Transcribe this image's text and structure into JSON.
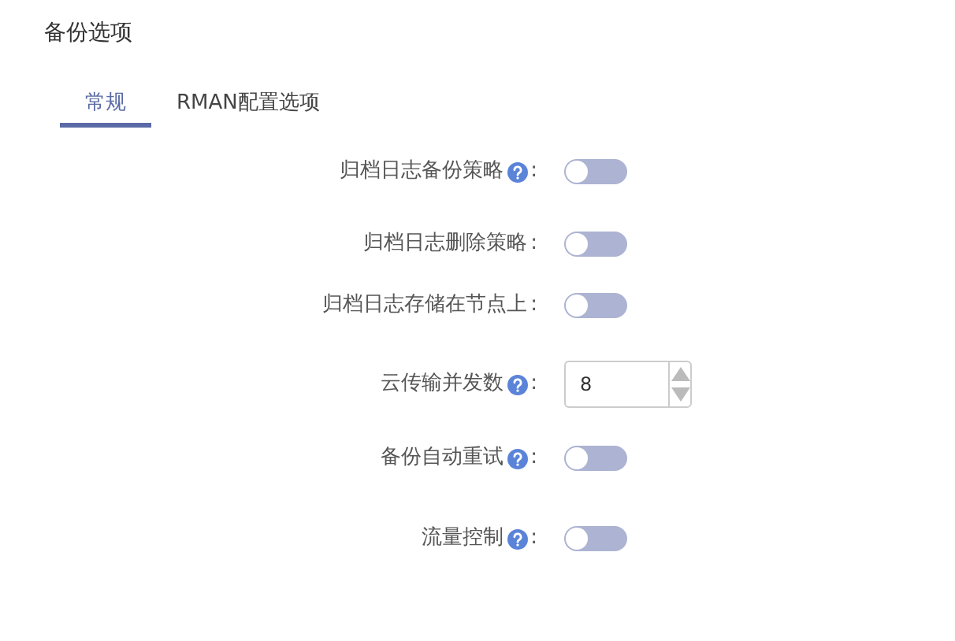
{
  "title": "备份选项",
  "tabs": [
    {
      "label": "常规",
      "selected": true
    },
    {
      "label": "RMAN配置选项",
      "selected": false
    }
  ],
  "fields": [
    {
      "kind": "switch",
      "label": "归档日志备份策略",
      "help": true,
      "colon": ":",
      "on": false
    },
    {
      "kind": "switch",
      "label": "归档日志删除策略",
      "help": false,
      "colon": ":",
      "on": false
    },
    {
      "kind": "switch",
      "label": "归档日志存储在节点上",
      "help": false,
      "colon": ":",
      "on": false
    },
    {
      "kind": "number",
      "label": "云传输并发数",
      "help": true,
      "colon": ":",
      "value": "8"
    },
    {
      "kind": "switch",
      "label": "备份自动重试",
      "help": true,
      "colon": ":",
      "on": false
    },
    {
      "kind": "switch",
      "label": "流量控制",
      "help": true,
      "colon": ":",
      "on": false
    }
  ]
}
